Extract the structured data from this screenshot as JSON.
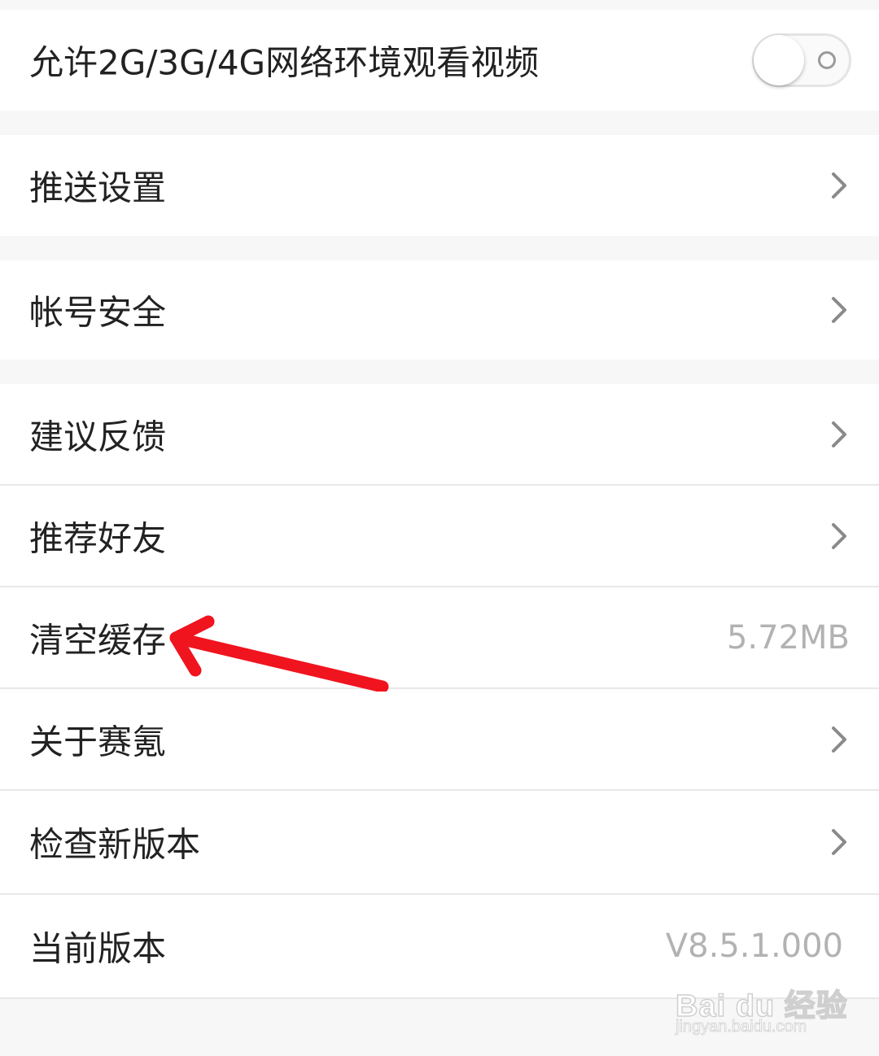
{
  "settings": {
    "network_video": {
      "label": "允许2G/3G/4G网络环境观看视频",
      "toggle_on": false
    },
    "push": {
      "label": "推送设置",
      "icon": "chevron-right-icon"
    },
    "account_security": {
      "label": "帐号安全",
      "icon": "chevron-right-icon"
    },
    "feedback": {
      "label": "建议反馈",
      "icon": "chevron-right-icon"
    },
    "recommend_friends": {
      "label": "推荐好友",
      "icon": "chevron-right-icon"
    },
    "clear_cache": {
      "label": "清空缓存",
      "value": "5.72MB"
    },
    "about": {
      "label": "关于赛氪",
      "icon": "chevron-right-icon"
    },
    "check_update": {
      "label": "检查新版本",
      "icon": "chevron-right-icon"
    },
    "current_version": {
      "label": "当前版本",
      "value": "V8.5.1.000"
    }
  },
  "annotation": {
    "arrow_color": "#f0141e"
  },
  "watermark": {
    "brand": "Bai du 经验",
    "url": "jingyan.baidu.com"
  },
  "colors": {
    "background": "#f7f7f7",
    "row_background": "#ffffff",
    "label_text": "#222222",
    "value_text": "#b2b2b2",
    "divider": "#e8e8e8"
  }
}
